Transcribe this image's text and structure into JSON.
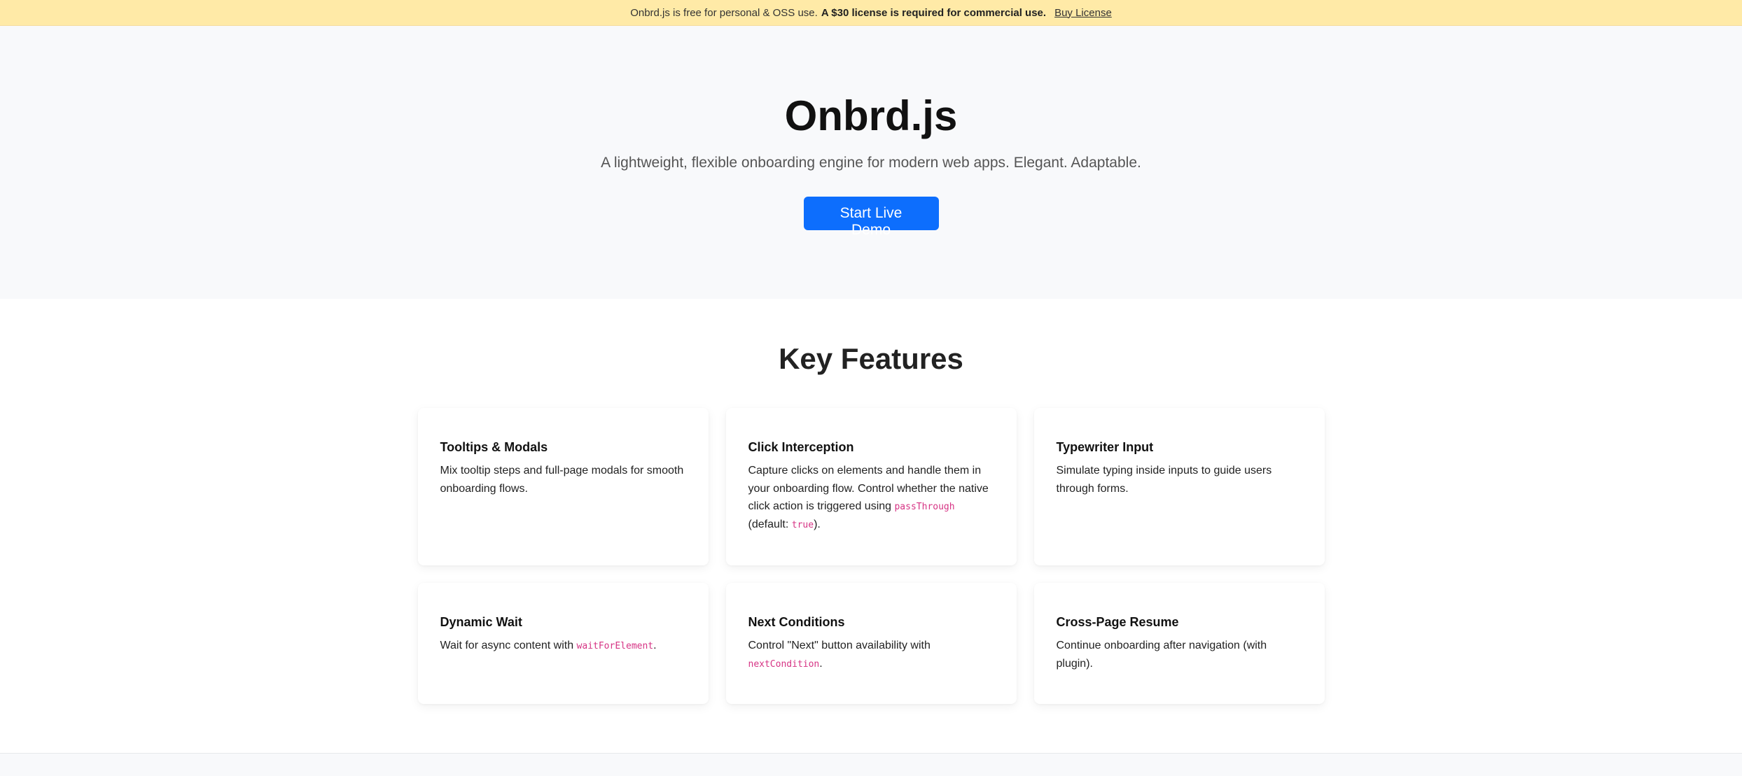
{
  "banner": {
    "text": "Onbrd.js is free for personal & OSS use.",
    "bold": "A $30 license is required for commercial use.",
    "link": "Buy License"
  },
  "hero": {
    "title": "Onbrd.js",
    "subtitle": "A lightweight, flexible onboarding engine for modern web apps. Elegant. Adaptable.",
    "cta": "Start Live Demo"
  },
  "features": {
    "heading": "Key Features",
    "items": [
      {
        "title": "Tooltips & Modals",
        "desc": [
          {
            "t": "Mix tooltip steps and full-page modals for smooth onboarding flows."
          }
        ]
      },
      {
        "title": "Click Interception",
        "desc": [
          {
            "t": "Capture clicks on elements and handle them in your onboarding flow. Control whether the native click action is triggered using "
          },
          {
            "c": "passThrough"
          },
          {
            "t": " (default: "
          },
          {
            "c": "true"
          },
          {
            "t": ")."
          }
        ]
      },
      {
        "title": "Typewriter Input",
        "desc": [
          {
            "t": "Simulate typing inside inputs to guide users through forms."
          }
        ]
      },
      {
        "title": "Dynamic Wait",
        "desc": [
          {
            "t": "Wait for async content with "
          },
          {
            "c": "waitForElement"
          },
          {
            "t": "."
          }
        ]
      },
      {
        "title": "Next Conditions",
        "desc": [
          {
            "t": "Control \"Next\" button availability with "
          },
          {
            "c": "nextCondition"
          },
          {
            "t": "."
          }
        ]
      },
      {
        "title": "Cross-Page Resume",
        "desc": [
          {
            "t": "Continue onboarding after navigation (with plugin)."
          }
        ]
      }
    ]
  },
  "colors": {
    "banner_bg": "#ffeaa7",
    "hero_bg": "#f8f9fb",
    "accent": "#0d6efd",
    "code": "#d63384"
  }
}
